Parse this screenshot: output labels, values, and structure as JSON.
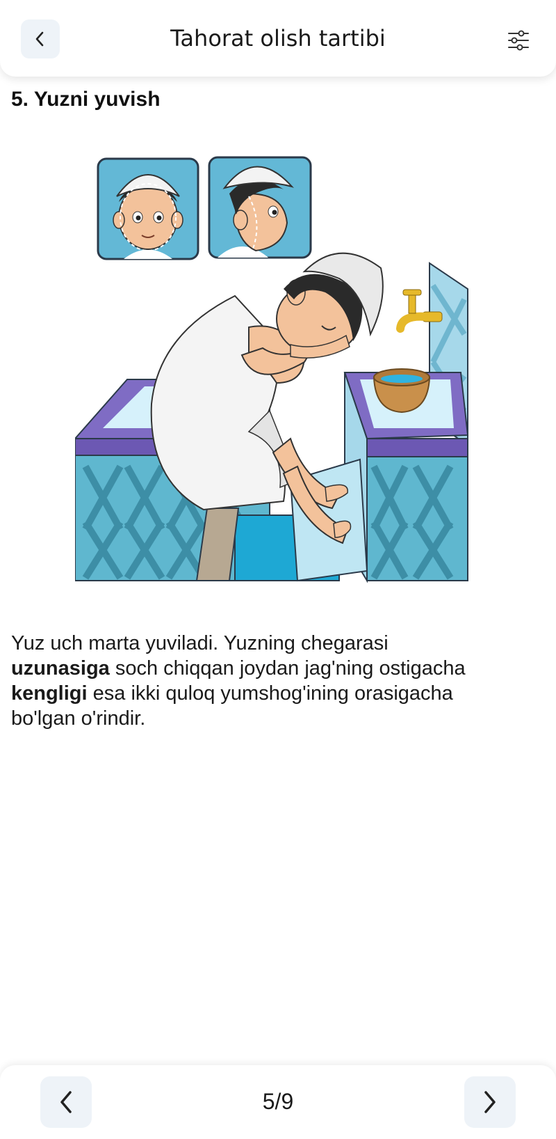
{
  "header": {
    "title": "Tahorat olish tartibi",
    "back_icon": "chevron-left-icon",
    "filter_icon": "sliders-icon"
  },
  "step": {
    "title": "5. Yuzni yuvish",
    "image": "boy-washing-face-illustration",
    "text": {
      "line1": "Yuz uch marta yuviladi. Yuzning chegarasi",
      "bold1": "uzunasiga",
      "line2": " soch chiqqan joydan jag'ning ostigacha",
      "bold2": "kengligi",
      "line3": " esa ikki quloq yumshog'ining orasigacha",
      "line4": "bo'lgan o'rindir."
    }
  },
  "footer": {
    "prev_icon": "chevron-left-icon",
    "next_icon": "chevron-right-icon",
    "pager": "5/9"
  },
  "colors": {
    "button_bg": "#eef3f8",
    "tile_blue": "#5fb7cf",
    "purple": "#7f6cc4"
  }
}
